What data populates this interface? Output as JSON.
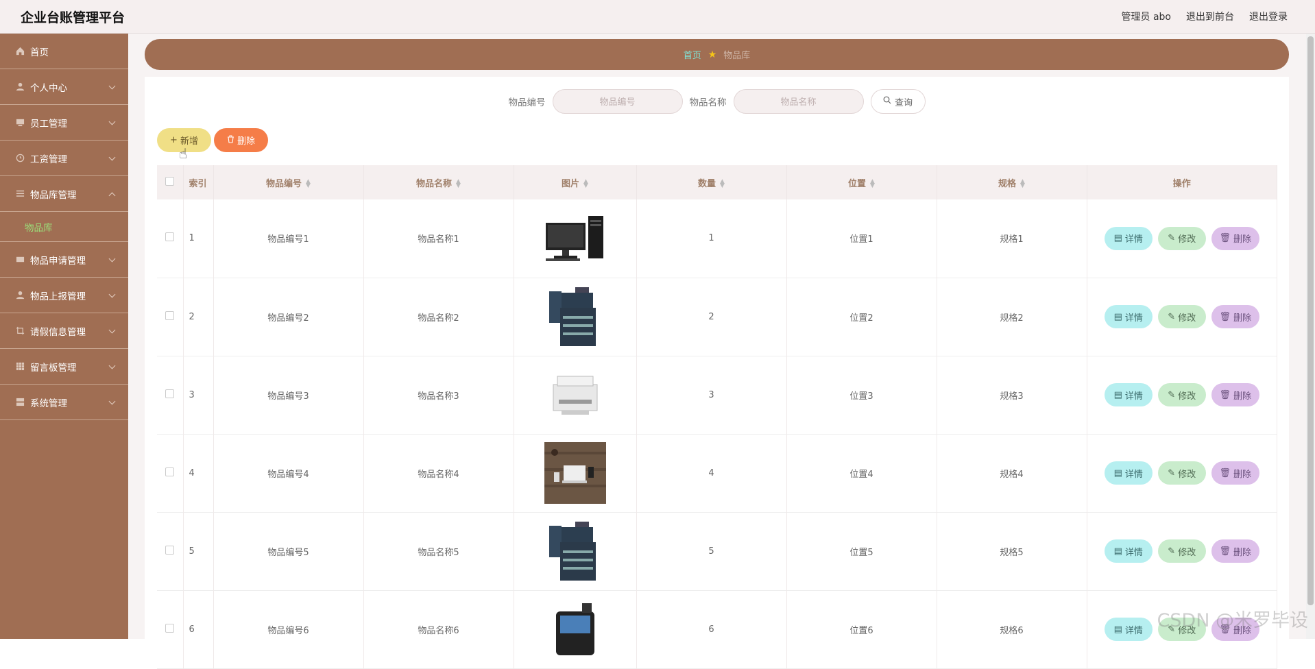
{
  "header": {
    "title": "企业台账管理平台",
    "links": [
      "管理员 abo",
      "退出到前台",
      "退出登录"
    ]
  },
  "sidebar": {
    "items": [
      {
        "label": "首页",
        "icon": "home-icon"
      },
      {
        "label": "个人中心",
        "icon": "user-icon"
      },
      {
        "label": "员工管理",
        "icon": "monitor-icon"
      },
      {
        "label": "工资管理",
        "icon": "clock-icon"
      },
      {
        "label": "物品库管理",
        "icon": "list-icon"
      },
      {
        "label": "物品申请管理",
        "icon": "card-icon"
      },
      {
        "label": "物品上报管理",
        "icon": "user-icon"
      },
      {
        "label": "请假信息管理",
        "icon": "crop-icon"
      },
      {
        "label": "留言板管理",
        "icon": "grid-icon"
      },
      {
        "label": "系统管理",
        "icon": "server-icon"
      }
    ],
    "submenu_label": "物品库"
  },
  "breadcrumb": {
    "home": "首页",
    "current": "物品库"
  },
  "search": {
    "code_label": "物品编号",
    "code_placeholder": "物品编号",
    "name_label": "物品名称",
    "name_placeholder": "物品名称",
    "query": "查询"
  },
  "actions": {
    "add": "新增",
    "delete": "删除"
  },
  "table": {
    "headers": [
      "索引",
      "物品编号",
      "物品名称",
      "图片",
      "数量",
      "位置",
      "规格",
      "操作"
    ],
    "rows": [
      {
        "index": "1",
        "code": "物品编号1",
        "name": "物品名称1",
        "image": "desktop-computer",
        "qty": "1",
        "loc": "位置1",
        "spec": "规格1"
      },
      {
        "index": "2",
        "code": "物品编号2",
        "name": "物品名称2",
        "image": "copier",
        "qty": "2",
        "loc": "位置2",
        "spec": "规格2"
      },
      {
        "index": "3",
        "code": "物品编号3",
        "name": "物品名称3",
        "image": "printer",
        "qty": "3",
        "loc": "位置3",
        "spec": "规格3"
      },
      {
        "index": "4",
        "code": "物品编号4",
        "name": "物品名称4",
        "image": "laptop-desk",
        "qty": "4",
        "loc": "位置4",
        "spec": "规格4"
      },
      {
        "index": "5",
        "code": "物品编号5",
        "name": "物品名称5",
        "image": "copier",
        "qty": "5",
        "loc": "位置5",
        "spec": "规格5"
      },
      {
        "index": "6",
        "code": "物品编号6",
        "name": "物品名称6",
        "image": "pos-terminal",
        "qty": "6",
        "loc": "位置6",
        "spec": "规格6"
      }
    ],
    "op_detail": "详情",
    "op_edit": "修改",
    "op_delete": "删除"
  },
  "watermark": "CSDN @米罗毕设"
}
